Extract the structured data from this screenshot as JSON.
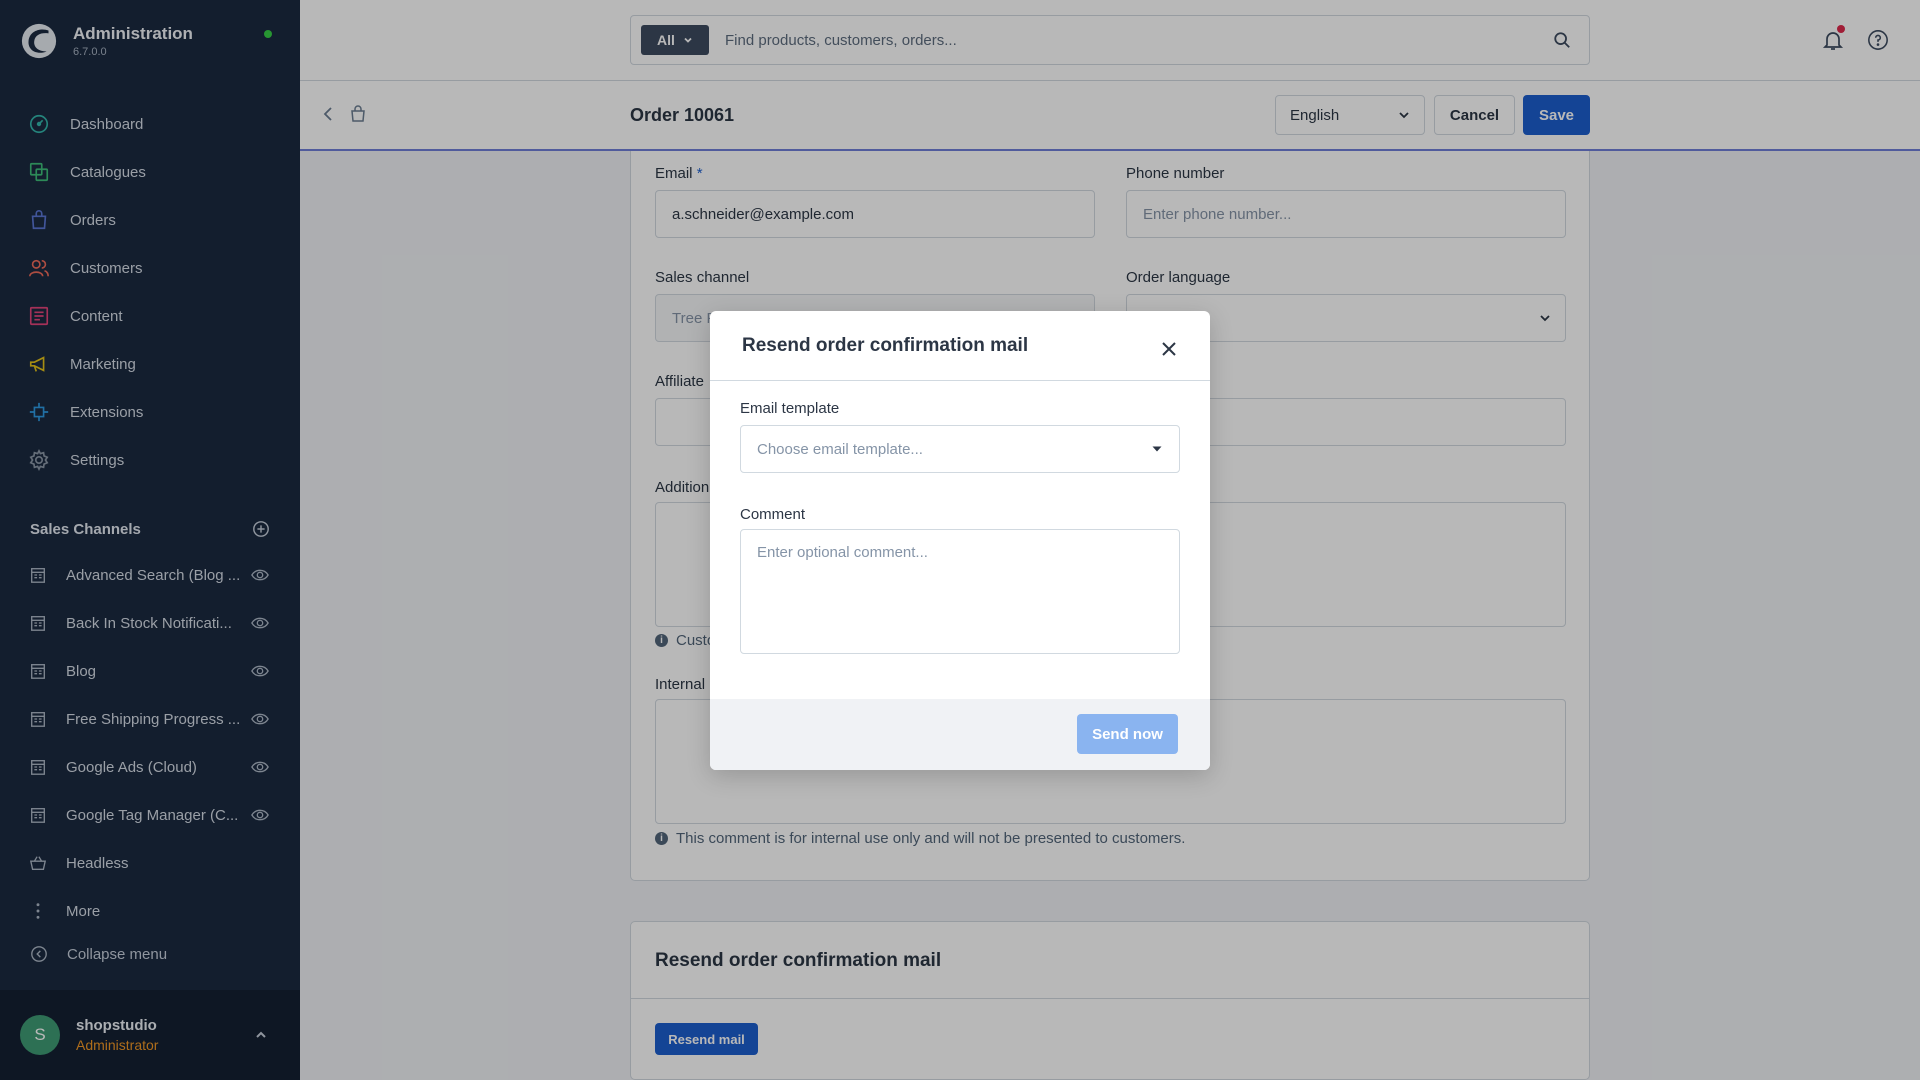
{
  "app": {
    "title": "Administration",
    "version": "6.7.0.0"
  },
  "nav": {
    "items": [
      {
        "label": "Dashboard",
        "icon": "dashboard-icon"
      },
      {
        "label": "Catalogues",
        "icon": "catalogues-icon"
      },
      {
        "label": "Orders",
        "icon": "orders-icon"
      },
      {
        "label": "Customers",
        "icon": "customers-icon"
      },
      {
        "label": "Content",
        "icon": "content-icon"
      },
      {
        "label": "Marketing",
        "icon": "marketing-icon"
      },
      {
        "label": "Extensions",
        "icon": "extensions-icon"
      },
      {
        "label": "Settings",
        "icon": "settings-icon"
      }
    ]
  },
  "sales_channels": {
    "title": "Sales Channels",
    "items": [
      {
        "label": "Advanced Search (Blog ..."
      },
      {
        "label": "Back In Stock Notificati..."
      },
      {
        "label": "Blog"
      },
      {
        "label": "Free Shipping Progress ..."
      },
      {
        "label": "Google Ads (Cloud)"
      },
      {
        "label": "Google Tag Manager (C..."
      },
      {
        "label": "Headless"
      },
      {
        "label": "More"
      }
    ],
    "collapse_label": "Collapse menu"
  },
  "user": {
    "initial": "S",
    "name": "shopstudio",
    "role": "Administrator"
  },
  "search": {
    "type_label": "All",
    "placeholder": "Find products, customers, orders..."
  },
  "smartbar": {
    "title": "Order 10061",
    "language": "English",
    "cancel_label": "Cancel",
    "save_label": "Save"
  },
  "form": {
    "email_label": "Email",
    "email_required": "*",
    "email_value": "a.schneider@example.com",
    "phone_label": "Phone number",
    "phone_placeholder": "Enter phone number...",
    "sales_channel_label": "Sales channel",
    "sales_channel_value": "Tree F",
    "order_language_label": "Order language",
    "affiliate_label": "Affiliate",
    "campaign_label_fragment": "ode",
    "additional_label": "Addition",
    "customer_hint_fragment": "Custo",
    "internal_label": "Internal",
    "internal_hint": "This comment is for internal use only and will not be presented to customers.",
    "info_glyph": "i"
  },
  "resend_card": {
    "title": "Resend order confirmation mail",
    "button_label": "Resend mail"
  },
  "modal": {
    "title": "Resend order confirmation mail",
    "template_label": "Email template",
    "template_placeholder": "Choose email template...",
    "comment_label": "Comment",
    "comment_placeholder": "Enter optional comment...",
    "send_label": "Send now"
  },
  "colors": {
    "primary": "#1d5fcf",
    "sidebar": "#1b2a41",
    "role": "#f19826",
    "online": "#37d046",
    "notification": "#de294c"
  }
}
